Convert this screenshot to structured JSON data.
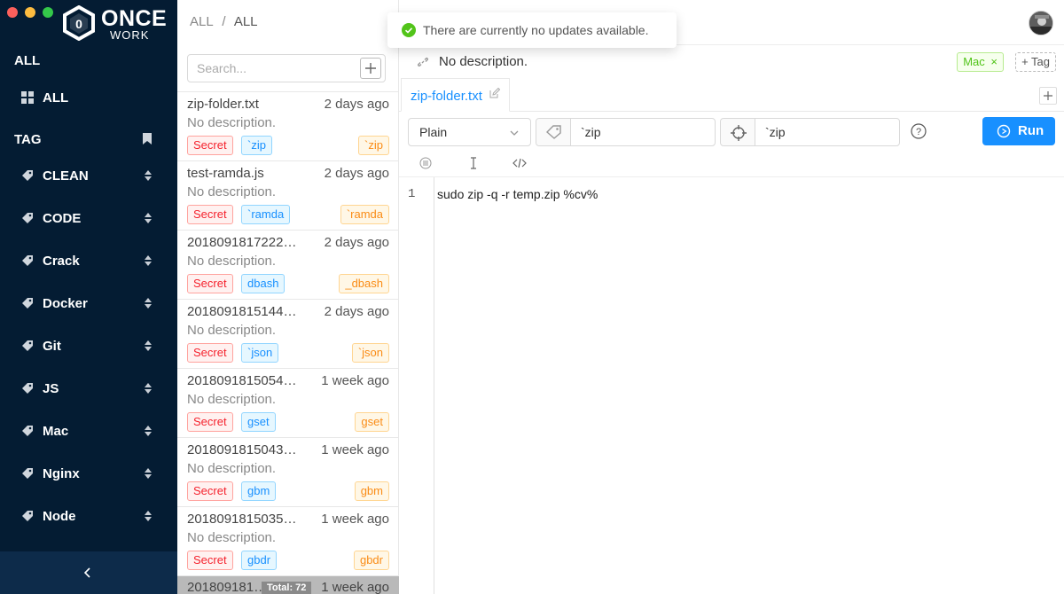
{
  "app": {
    "logo_primary": "ONCE",
    "logo_secondary": "WORK",
    "logo_glyph": "0",
    "window_controls": [
      "#fc605c",
      "#fdbc40",
      "#34c84a"
    ]
  },
  "sidebar": {
    "section_all": "ALL",
    "all_item": {
      "label": "ALL",
      "icon": "grid-icon"
    },
    "section_tag": "TAG",
    "tag_items": [
      {
        "label": "CLEAN"
      },
      {
        "label": "CODE"
      },
      {
        "label": "Crack"
      },
      {
        "label": "Docker"
      },
      {
        "label": "Git"
      },
      {
        "label": "JS"
      },
      {
        "label": "Mac"
      },
      {
        "label": "Nginx"
      },
      {
        "label": "Node"
      }
    ],
    "collapse_glyph": "‹"
  },
  "breadcrumb": {
    "root": "ALL",
    "separator": "/",
    "current": "ALL"
  },
  "search": {
    "placeholder": "Search...",
    "add_glyph": "+"
  },
  "snippets": [
    {
      "name": "zip-folder.txt",
      "time": "2 days ago",
      "desc": "No description.",
      "tags": [
        "Secret",
        "`zip",
        "`zip"
      ]
    },
    {
      "name": "test-ramda.js",
      "time": "2 days ago",
      "desc": "No description.",
      "tags": [
        "Secret",
        "`ramda",
        "`ramda"
      ]
    },
    {
      "name": "2018091817222…",
      "time": "2 days ago",
      "desc": "No description.",
      "tags": [
        "Secret",
        "dbash",
        "_dbash"
      ]
    },
    {
      "name": "2018091815144…",
      "time": "2 days ago",
      "desc": "No description.",
      "tags": [
        "Secret",
        "`json",
        "`json"
      ]
    },
    {
      "name": "2018091815054…",
      "time": "1 week ago",
      "desc": "No description.",
      "tags": [
        "Secret",
        "gset",
        "gset"
      ]
    },
    {
      "name": "2018091815043…",
      "time": "1 week ago",
      "desc": "No description.",
      "tags": [
        "Secret",
        "gbm",
        "gbm"
      ]
    },
    {
      "name": "2018091815035…",
      "time": "1 week ago",
      "desc": "No description.",
      "tags": [
        "Secret",
        "gbdr",
        "gbdr"
      ]
    }
  ],
  "partial_item": {
    "name": "201809181…",
    "time": "1 week ago"
  },
  "list_total": "Total: 72",
  "toast": {
    "message": "There are currently no updates available."
  },
  "detail": {
    "description": "No description.",
    "tags": [
      "Mac"
    ],
    "add_tag_label": "+ Tag",
    "tab_label": "zip-folder.txt",
    "language": "Plain",
    "keyword": "`zip",
    "trigger": "`zip",
    "help_glyph": "?",
    "run_label": "Run",
    "code_lines": [
      {
        "no": "1",
        "text": "sudo zip -q -r temp.zip %cv%"
      }
    ]
  }
}
